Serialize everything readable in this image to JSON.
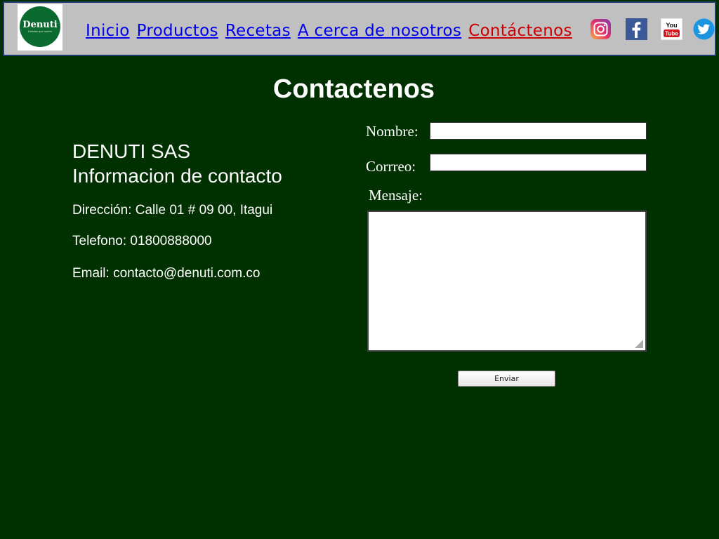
{
  "header": {
    "logo": {
      "text": "Denuti",
      "tagline": "Delicias que nutren"
    },
    "nav": [
      {
        "label": "Inicio"
      },
      {
        "label": "Productos"
      },
      {
        "label": "Recetas"
      },
      {
        "label": "A cerca de nosotros"
      },
      {
        "label": "Contáctenos",
        "active": true
      }
    ],
    "social": [
      {
        "icon": "instagram-icon"
      },
      {
        "icon": "facebook-icon"
      },
      {
        "icon": "youtube-icon",
        "text_top": "You",
        "text_bottom": "Tube"
      },
      {
        "icon": "twitter-icon"
      }
    ],
    "colors": {
      "bar": "#c0c0c0",
      "link": "#0000ee",
      "active_link": "#cc0000"
    }
  },
  "page": {
    "title": "Contactenos",
    "background": "#013001"
  },
  "contact_info": {
    "company": "DENUTI SAS",
    "heading": "Informacion de contacto",
    "address": "Dirección: Calle 01 # 09 00, Itagui",
    "phone": "Telefono: 01800888000",
    "email": "Email: contacto@denuti.com.co"
  },
  "form": {
    "name_label": "Nombre:",
    "name_value": "",
    "email_label": "Corrreo:",
    "email_value": "",
    "message_label": "Mensaje:",
    "message_value": "",
    "submit_label": "Enviar"
  }
}
